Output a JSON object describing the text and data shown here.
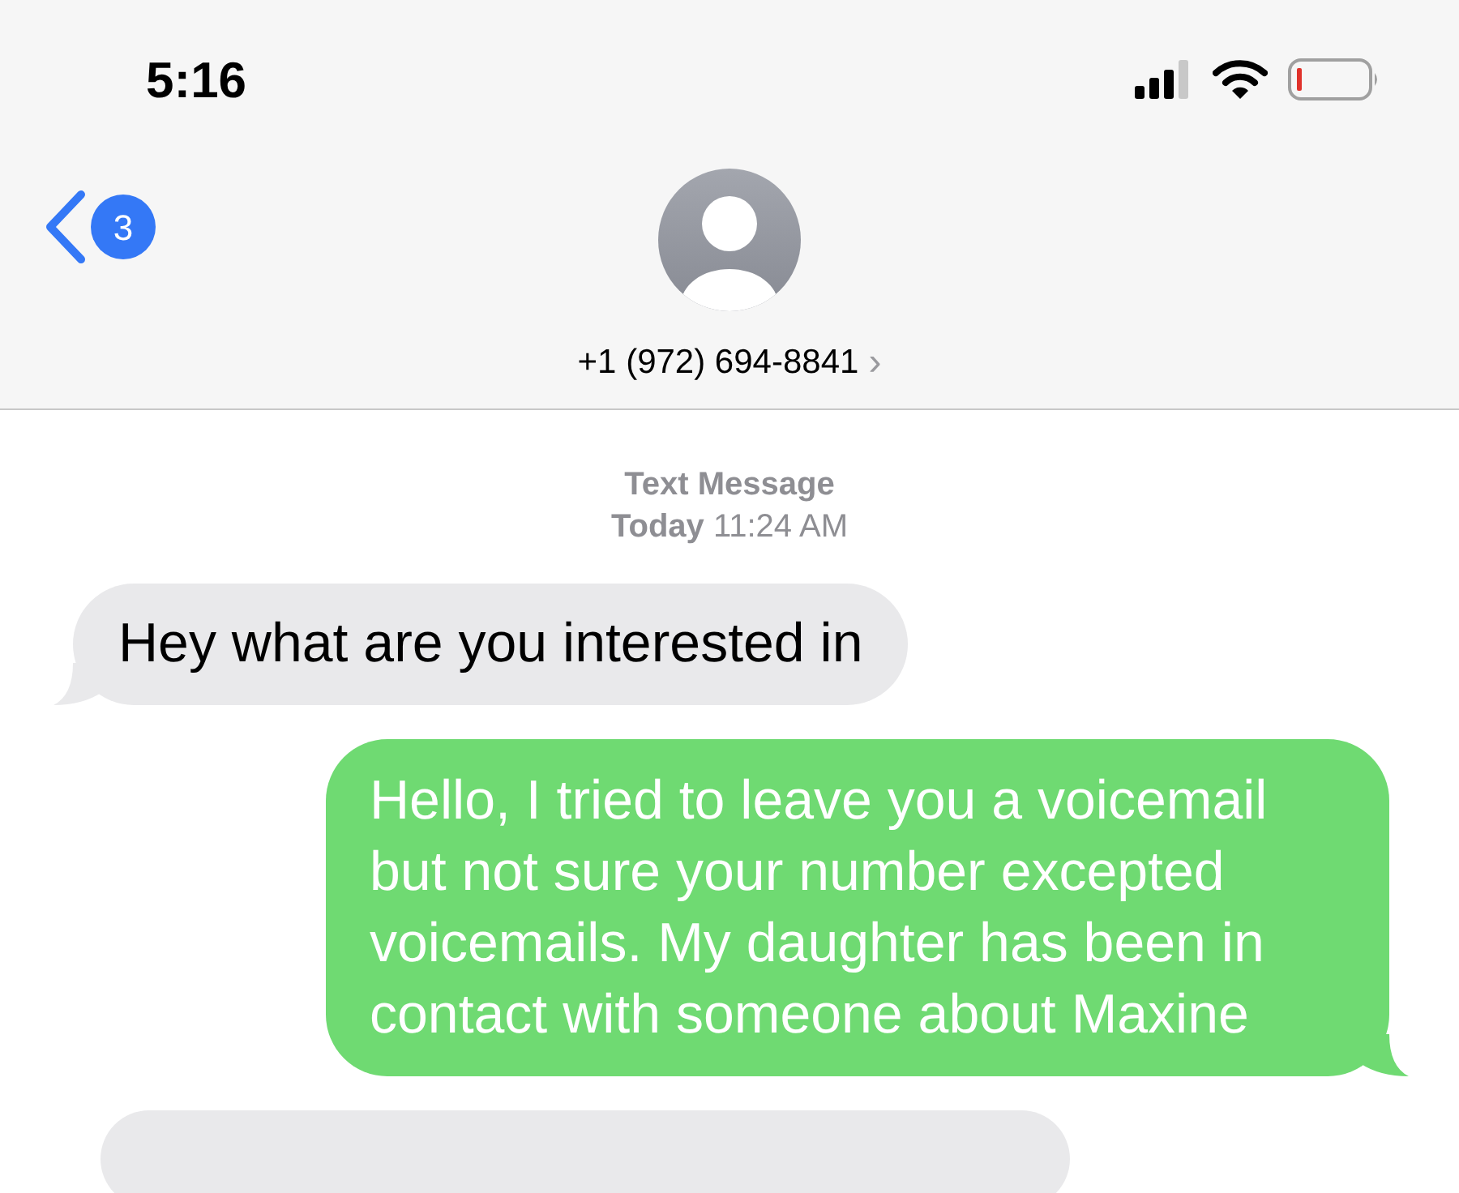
{
  "status_bar": {
    "time": "5:16"
  },
  "header": {
    "back_badge": "3",
    "contact": "+1 (972) 694-8841",
    "chevron": "›"
  },
  "thread": {
    "service": "Text Message",
    "timestamp": "**Today** 11:24 AM"
  },
  "messages": [
    {
      "kind": "received",
      "text": "Hey what are you interested in"
    },
    {
      "kind": "sent",
      "text": "Hello, I tried to leave you a voicemail but not sure your number excepted voicemails. My daughter has been in contact with someone about Maxine"
    },
    {
      "kind": "received"
    }
  ]
}
